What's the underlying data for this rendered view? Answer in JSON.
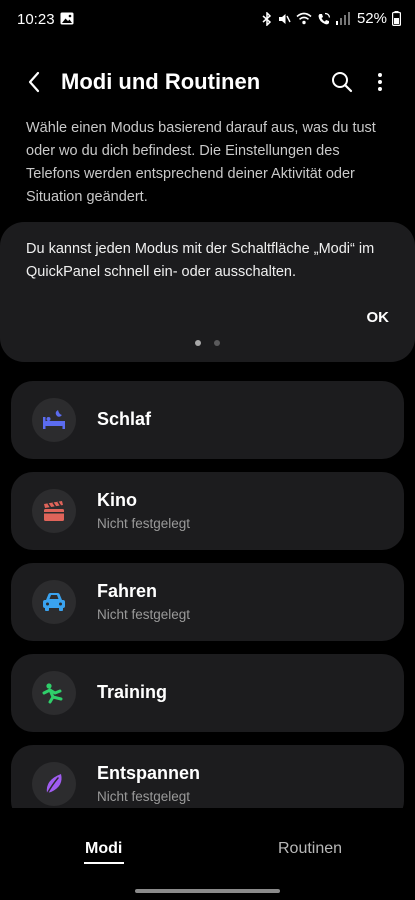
{
  "status_bar": {
    "time": "10:23",
    "battery": "52%"
  },
  "header": {
    "title": "Modi und Routinen"
  },
  "description": "Wähle einen Modus basierend darauf aus, was du tust oder wo du dich befindest. Die Einstellungen des Telefons werden entsprechend deiner Aktivität oder Situation geändert.",
  "tip": {
    "text": "Du kannst jeden Modus mit der Schaltfläche „Modi“ im QuickPanel schnell ein- oder ausschalten.",
    "ok_label": "OK"
  },
  "modes": [
    {
      "title": "Schlaf",
      "subtitle": "",
      "icon": "bed-icon",
      "color": "#5b6cf0"
    },
    {
      "title": "Kino",
      "subtitle": "Nicht festgelegt",
      "icon": "clapperboard-icon",
      "color": "#e0645a"
    },
    {
      "title": "Fahren",
      "subtitle": "Nicht festgelegt",
      "icon": "car-icon",
      "color": "#3aa3f0"
    },
    {
      "title": "Training",
      "subtitle": "",
      "icon": "running-icon",
      "color": "#2fcf6a"
    },
    {
      "title": "Entspannen",
      "subtitle": "Nicht festgelegt",
      "icon": "leaf-icon",
      "color": "#a05cf0"
    }
  ],
  "bottom_nav": {
    "tabs": [
      {
        "label": "Modi",
        "active": true
      },
      {
        "label": "Routinen",
        "active": false
      }
    ]
  }
}
